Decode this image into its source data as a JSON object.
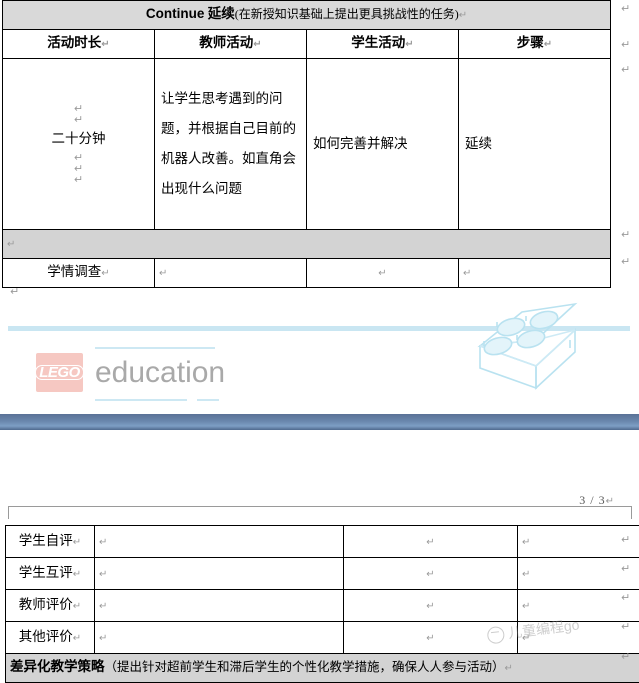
{
  "document": {
    "page_indicator": "3 / 3",
    "pilcrow": "↵"
  },
  "top_table": {
    "banner": {
      "english": "Continue",
      "chinese_bold": " 延续",
      "note": "(在新授知识基础上提出更具挑战性的任务)"
    },
    "columns": [
      "活动时长",
      "教师活动",
      "学生活动",
      "步骤"
    ],
    "rows": [
      {
        "duration": "二十分钟",
        "teacher_activity": "让学生思考遇到的问题，并根据自己目前的机器人改善。如直角会出现什么问题",
        "student_activity": "如何完善并解决",
        "step": "延续"
      }
    ],
    "spacer_row": "",
    "survey_row": {
      "label": "学情调查",
      "teacher_activity": "",
      "student_activity": "",
      "step": ""
    }
  },
  "footer_brand": {
    "lego_mark": "LEGO",
    "education": "education"
  },
  "bottom_table": {
    "rows": [
      {
        "label": "学生自评",
        "c2": "",
        "c3": "",
        "c4": ""
      },
      {
        "label": "学生互评",
        "c2": "",
        "c3": "",
        "c4": ""
      },
      {
        "label": "教师评价",
        "c2": "",
        "c3": "",
        "c4": ""
      },
      {
        "label": "其他评价",
        "c2": "",
        "c3": "",
        "c4": ""
      }
    ],
    "strategy": {
      "title": "差异化教学策略",
      "detail": "（提出针对超前学生和滞后学生的个性化教学措施，确保人人参与活动）"
    }
  },
  "watermark": {
    "text": "儿童编程go"
  },
  "colors": {
    "header_gray": "#d9d9d9",
    "spacer_gray": "#d3d3d3",
    "lego_red": "#f6c8c2",
    "rule_blue": "#c9e6f2",
    "bar_blue": "#6a87ad"
  }
}
